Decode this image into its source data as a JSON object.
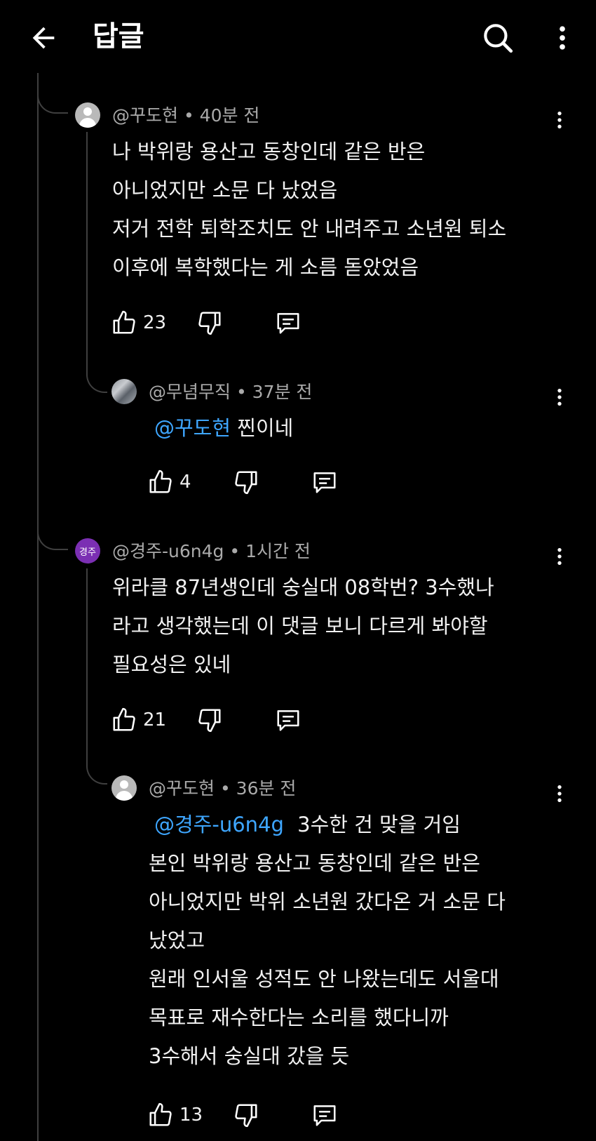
{
  "header": {
    "title": "답글"
  },
  "comments": [
    {
      "author": "@꾸도현",
      "time": "40분 전",
      "lines": [
        "나 박위랑 용산고 동창인데 같은 반은",
        "아니었지만 소문 다 났었음",
        "저거 전학 퇴학조치도 안 내려주고 소년원 퇴소",
        "이후에 복학했다는 게 소름 돋았었음"
      ],
      "likes": "23",
      "reply": {
        "author": "@무념무직",
        "time": "37분 전",
        "mention": "@꾸도현",
        "text": "찐이네",
        "likes": "4"
      }
    },
    {
      "author": "@경주-u6n4g",
      "avatar_text": "경주",
      "time": "1시간 전",
      "lines": [
        "위라클 87년생인데 숭실대 08학번? 3수했나",
        "라고 생각했는데 이 댓글 보니 다르게 봐야할",
        "필요성은 있네"
      ],
      "likes": "21",
      "reply": {
        "author": "@꾸도현",
        "time": "36분 전",
        "mention": "@경주-u6n4g",
        "first_line": "3수한 건 맞을 거임",
        "lines": [
          "본인 박위랑 용산고 동창인데 같은 반은",
          "아니었지만 박위 소년원 갔다온 거 소문 다",
          "났었고",
          "원래 인서울 성적도 안 나왔는데도 서울대",
          "목표로 재수한다는 소리를 했다니까",
          "3수해서 숭실대 갔을 듯"
        ],
        "likes": "13"
      }
    }
  ],
  "separator": "•",
  "icons": [
    "back-arrow-icon",
    "search-icon",
    "more-vert-icon",
    "thumb-up-icon",
    "thumb-down-icon",
    "reply-icon",
    "default-avatar-icon"
  ],
  "colors": {
    "background": "#000000",
    "text": "#f1f1f1",
    "meta": "#aaaaaa",
    "mention": "#3ea6ff",
    "avatar_purple": "#7b2fb3"
  }
}
